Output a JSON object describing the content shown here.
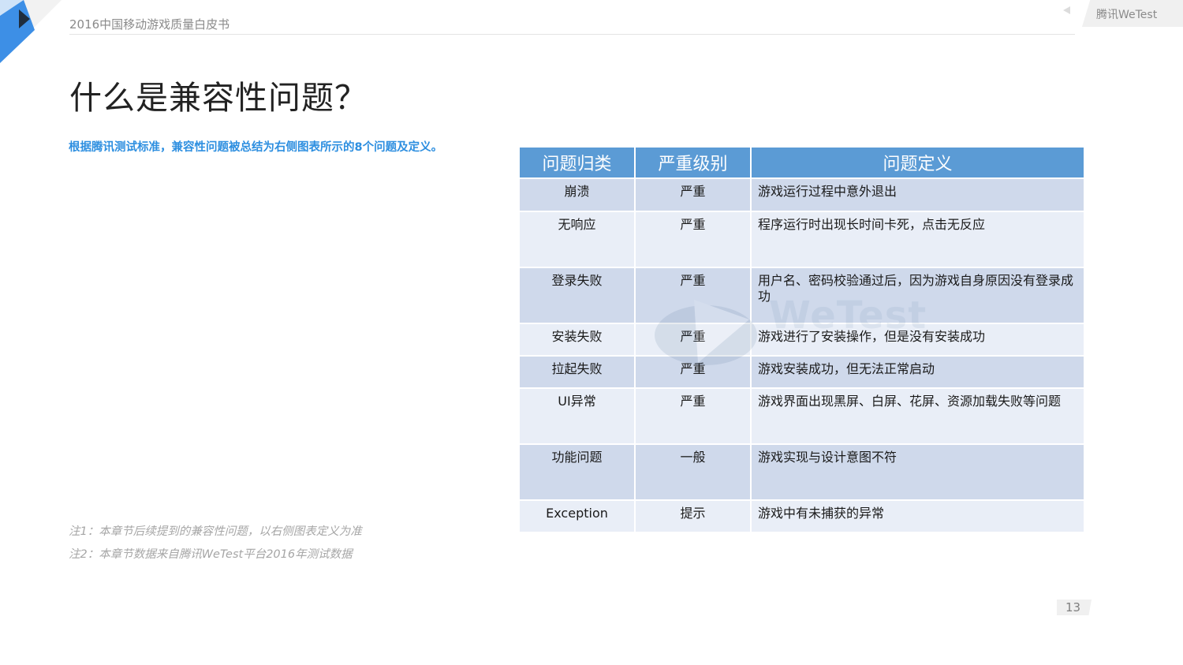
{
  "header": {
    "title": "2016中国移动游戏质量白皮书",
    "brand": "腾讯WeTest"
  },
  "page": {
    "heading": "什么是兼容性问题？",
    "intro": "根据腾讯测试标准，兼容性问题被总结为右侧图表所示的8个问题及定义。",
    "notes": [
      "注1：本章节后续提到的兼容性问题，以右侧图表定义为准",
      "注2：本章节数据来自腾讯WeTest平台2016年测试数据"
    ],
    "page_number": "13"
  },
  "table": {
    "headers": [
      "问题归类",
      "严重级别",
      "问题定义"
    ],
    "rows": [
      {
        "category": "崩溃",
        "severity": "严重",
        "definition": "游戏运行过程中意外退出"
      },
      {
        "category": "无响应",
        "severity": "严重",
        "definition": "程序运行时出现长时间卡死，点击无反应"
      },
      {
        "category": "登录失败",
        "severity": "严重",
        "definition": "用户名、密码校验通过后，因为游戏自身原因没有登录成功"
      },
      {
        "category": "安装失败",
        "severity": "严重",
        "definition": "游戏进行了安装操作，但是没有安装成功"
      },
      {
        "category": "拉起失败",
        "severity": "严重",
        "definition": "游戏安装成功，但无法正常启动"
      },
      {
        "category": "UI异常",
        "severity": "严重",
        "definition": "游戏界面出现黑屏、白屏、花屏、资源加载失败等问题"
      },
      {
        "category": "功能问题",
        "severity": "一般",
        "definition": "游戏实现与设计意图不符"
      },
      {
        "category": "Exception",
        "severity": "提示",
        "definition": "游戏中有未捕获的异常"
      }
    ]
  },
  "watermark": {
    "text": "WeTest"
  },
  "colors": {
    "accent": "#2e8fe0",
    "table_header": "#5b9bd5",
    "row_odd": "#cfd9eb",
    "row_even": "#e9eef7"
  }
}
